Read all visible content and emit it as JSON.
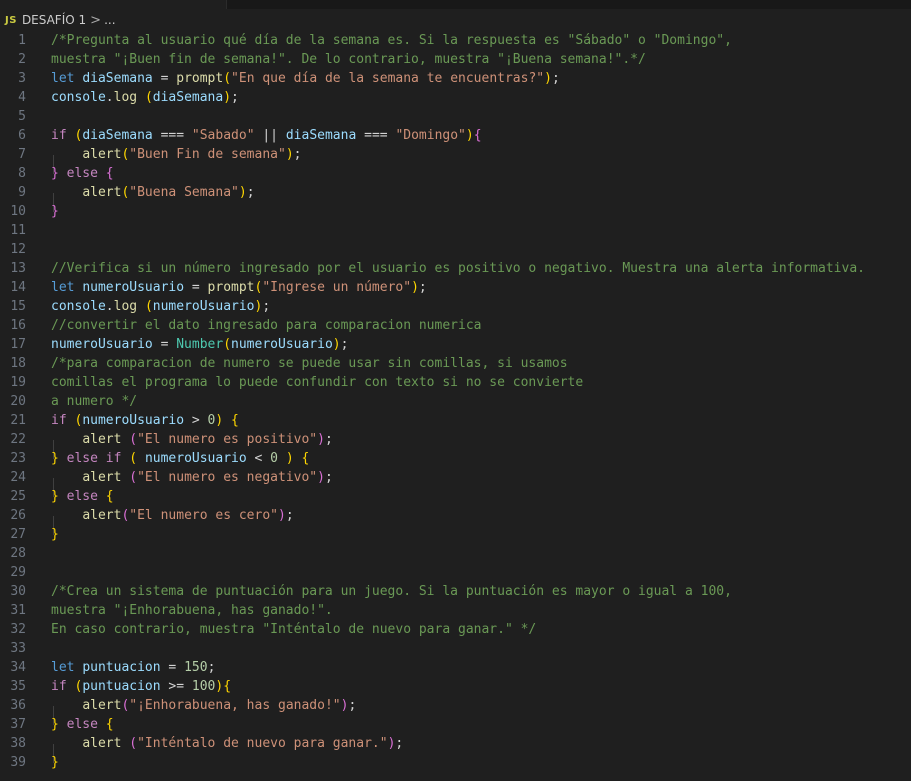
{
  "breadcrumb": {
    "file_icon_label": "JS",
    "folder": "DESAFÍO 1",
    "separator": ">",
    "more": "..."
  },
  "colors": {
    "comment": "#6a9955",
    "keyword": "#569cd6",
    "control": "#c586c0",
    "variable": "#9cdcfe",
    "function": "#dcdcaa",
    "string": "#ce9178",
    "number": "#b5cea8",
    "type": "#4ec9b0",
    "bracket_level1": "#ffd700",
    "bracket_level2": "#da70d6"
  },
  "lines": [
    {
      "n": "1",
      "t": [
        {
          "c": "comment",
          "v": "/*Pregunta al usuario qué día de la semana es. Si la respuesta es \"Sábado\" o \"Domingo\","
        }
      ]
    },
    {
      "n": "2",
      "t": [
        {
          "c": "comment",
          "v": "muestra \"¡Buen fin de semana!\". De lo contrario, muestra \"¡Buena semana!\".*/"
        }
      ]
    },
    {
      "n": "3",
      "t": [
        {
          "c": "kw",
          "v": "let"
        },
        {
          "c": "op",
          "v": " "
        },
        {
          "c": "var",
          "v": "diaSemana"
        },
        {
          "c": "op",
          "v": " = "
        },
        {
          "c": "fn",
          "v": "prompt"
        },
        {
          "c": "b1",
          "v": "("
        },
        {
          "c": "str",
          "v": "\"En que día de la semana te encuentras?\""
        },
        {
          "c": "b1",
          "v": ")"
        },
        {
          "c": "op",
          "v": ";"
        }
      ]
    },
    {
      "n": "4",
      "t": [
        {
          "c": "var",
          "v": "console"
        },
        {
          "c": "op",
          "v": "."
        },
        {
          "c": "fn",
          "v": "log"
        },
        {
          "c": "op",
          "v": " "
        },
        {
          "c": "b1",
          "v": "("
        },
        {
          "c": "var",
          "v": "diaSemana"
        },
        {
          "c": "b1",
          "v": ")"
        },
        {
          "c": "op",
          "v": ";"
        }
      ]
    },
    {
      "n": "5",
      "t": []
    },
    {
      "n": "6",
      "t": [
        {
          "c": "ctrl",
          "v": "if"
        },
        {
          "c": "op",
          "v": " "
        },
        {
          "c": "b1",
          "v": "("
        },
        {
          "c": "var",
          "v": "diaSemana"
        },
        {
          "c": "op",
          "v": " === "
        },
        {
          "c": "str",
          "v": "\"Sabado\""
        },
        {
          "c": "op",
          "v": " || "
        },
        {
          "c": "var",
          "v": "diaSemana"
        },
        {
          "c": "op",
          "v": " === "
        },
        {
          "c": "str",
          "v": "\"Domingo\""
        },
        {
          "c": "b1",
          "v": ")"
        },
        {
          "c": "b2",
          "v": "{"
        }
      ]
    },
    {
      "n": "7",
      "t": [
        {
          "c": "op",
          "v": "    "
        },
        {
          "c": "fn",
          "v": "alert"
        },
        {
          "c": "b1",
          "v": "("
        },
        {
          "c": "str",
          "v": "\"Buen Fin de semana\""
        },
        {
          "c": "b1",
          "v": ")"
        },
        {
          "c": "op",
          "v": ";"
        }
      ]
    },
    {
      "n": "8",
      "t": [
        {
          "c": "b2",
          "v": "}"
        },
        {
          "c": "op",
          "v": " "
        },
        {
          "c": "ctrl",
          "v": "else"
        },
        {
          "c": "op",
          "v": " "
        },
        {
          "c": "b2",
          "v": "{"
        }
      ]
    },
    {
      "n": "9",
      "t": [
        {
          "c": "op",
          "v": "    "
        },
        {
          "c": "fn",
          "v": "alert"
        },
        {
          "c": "b1",
          "v": "("
        },
        {
          "c": "str",
          "v": "\"Buena Semana\""
        },
        {
          "c": "b1",
          "v": ")"
        },
        {
          "c": "op",
          "v": ";"
        }
      ]
    },
    {
      "n": "10",
      "t": [
        {
          "c": "b2",
          "v": "}"
        }
      ]
    },
    {
      "n": "11",
      "t": []
    },
    {
      "n": "12",
      "t": []
    },
    {
      "n": "13",
      "t": [
        {
          "c": "comment",
          "v": "//Verifica si un número ingresado por el usuario es positivo o negativo. Muestra una alerta informativa."
        }
      ]
    },
    {
      "n": "14",
      "t": [
        {
          "c": "kw",
          "v": "let"
        },
        {
          "c": "op",
          "v": " "
        },
        {
          "c": "var",
          "v": "numeroUsuario"
        },
        {
          "c": "op",
          "v": " = "
        },
        {
          "c": "fn",
          "v": "prompt"
        },
        {
          "c": "b1",
          "v": "("
        },
        {
          "c": "str",
          "v": "\"Ingrese un número\""
        },
        {
          "c": "b1",
          "v": ")"
        },
        {
          "c": "op",
          "v": ";"
        }
      ]
    },
    {
      "n": "15",
      "t": [
        {
          "c": "var",
          "v": "console"
        },
        {
          "c": "op",
          "v": "."
        },
        {
          "c": "fn",
          "v": "log"
        },
        {
          "c": "op",
          "v": " "
        },
        {
          "c": "b1",
          "v": "("
        },
        {
          "c": "var",
          "v": "numeroUsuario"
        },
        {
          "c": "b1",
          "v": ")"
        },
        {
          "c": "op",
          "v": ";"
        }
      ]
    },
    {
      "n": "16",
      "t": [
        {
          "c": "comment",
          "v": "//convertir el dato ingresado para comparacion numerica"
        }
      ]
    },
    {
      "n": "17",
      "t": [
        {
          "c": "var",
          "v": "numeroUsuario"
        },
        {
          "c": "op",
          "v": " = "
        },
        {
          "c": "type",
          "v": "Number"
        },
        {
          "c": "b1",
          "v": "("
        },
        {
          "c": "var",
          "v": "numeroUsuario"
        },
        {
          "c": "b1",
          "v": ")"
        },
        {
          "c": "op",
          "v": ";"
        }
      ]
    },
    {
      "n": "18",
      "t": [
        {
          "c": "comment",
          "v": "/*para comparacion de numero se puede usar sin comillas, si usamos"
        }
      ]
    },
    {
      "n": "19",
      "t": [
        {
          "c": "comment",
          "v": "comillas el programa lo puede confundir con texto si no se convierte"
        }
      ]
    },
    {
      "n": "20",
      "t": [
        {
          "c": "comment",
          "v": "a numero */"
        }
      ]
    },
    {
      "n": "21",
      "t": [
        {
          "c": "ctrl",
          "v": "if"
        },
        {
          "c": "op",
          "v": " "
        },
        {
          "c": "b1",
          "v": "("
        },
        {
          "c": "var",
          "v": "numeroUsuario"
        },
        {
          "c": "op",
          "v": " > "
        },
        {
          "c": "num",
          "v": "0"
        },
        {
          "c": "b1",
          "v": ")"
        },
        {
          "c": "op",
          "v": " "
        },
        {
          "c": "b1",
          "v": "{"
        }
      ]
    },
    {
      "n": "22",
      "t": [
        {
          "c": "op",
          "v": "    "
        },
        {
          "c": "fn",
          "v": "alert"
        },
        {
          "c": "op",
          "v": " "
        },
        {
          "c": "b2",
          "v": "("
        },
        {
          "c": "str",
          "v": "\"El numero es positivo\""
        },
        {
          "c": "b2",
          "v": ")"
        },
        {
          "c": "op",
          "v": ";"
        }
      ]
    },
    {
      "n": "23",
      "t": [
        {
          "c": "b1",
          "v": "}"
        },
        {
          "c": "op",
          "v": " "
        },
        {
          "c": "ctrl",
          "v": "else"
        },
        {
          "c": "op",
          "v": " "
        },
        {
          "c": "ctrl",
          "v": "if"
        },
        {
          "c": "op",
          "v": " "
        },
        {
          "c": "b1",
          "v": "("
        },
        {
          "c": "op",
          "v": " "
        },
        {
          "c": "var",
          "v": "numeroUsuario"
        },
        {
          "c": "op",
          "v": " < "
        },
        {
          "c": "num",
          "v": "0"
        },
        {
          "c": "op",
          "v": " "
        },
        {
          "c": "b1",
          "v": ")"
        },
        {
          "c": "op",
          "v": " "
        },
        {
          "c": "b1",
          "v": "{"
        }
      ]
    },
    {
      "n": "24",
      "t": [
        {
          "c": "op",
          "v": "    "
        },
        {
          "c": "fn",
          "v": "alert"
        },
        {
          "c": "op",
          "v": " "
        },
        {
          "c": "b2",
          "v": "("
        },
        {
          "c": "str",
          "v": "\"El numero es negativo\""
        },
        {
          "c": "b2",
          "v": ")"
        },
        {
          "c": "op",
          "v": ";"
        }
      ]
    },
    {
      "n": "25",
      "t": [
        {
          "c": "b1",
          "v": "}"
        },
        {
          "c": "op",
          "v": " "
        },
        {
          "c": "ctrl",
          "v": "else"
        },
        {
          "c": "op",
          "v": " "
        },
        {
          "c": "b1",
          "v": "{"
        }
      ]
    },
    {
      "n": "26",
      "t": [
        {
          "c": "op",
          "v": "    "
        },
        {
          "c": "fn",
          "v": "alert"
        },
        {
          "c": "b2",
          "v": "("
        },
        {
          "c": "str",
          "v": "\"El numero es cero\""
        },
        {
          "c": "b2",
          "v": ")"
        },
        {
          "c": "op",
          "v": ";"
        }
      ]
    },
    {
      "n": "27",
      "t": [
        {
          "c": "b1",
          "v": "}"
        }
      ]
    },
    {
      "n": "28",
      "t": []
    },
    {
      "n": "29",
      "t": []
    },
    {
      "n": "30",
      "t": [
        {
          "c": "comment",
          "v": "/*Crea un sistema de puntuación para un juego. Si la puntuación es mayor o igual a 100,"
        }
      ]
    },
    {
      "n": "31",
      "t": [
        {
          "c": "comment",
          "v": "muestra \"¡Enhorabuena, has ganado!\"."
        }
      ]
    },
    {
      "n": "32",
      "t": [
        {
          "c": "comment",
          "v": "En caso contrario, muestra \"Inténtalo de nuevo para ganar.\" */"
        }
      ]
    },
    {
      "n": "33",
      "t": []
    },
    {
      "n": "34",
      "t": [
        {
          "c": "kw",
          "v": "let"
        },
        {
          "c": "op",
          "v": " "
        },
        {
          "c": "var",
          "v": "puntuacion"
        },
        {
          "c": "op",
          "v": " = "
        },
        {
          "c": "num",
          "v": "150"
        },
        {
          "c": "op",
          "v": ";"
        }
      ]
    },
    {
      "n": "35",
      "t": [
        {
          "c": "ctrl",
          "v": "if"
        },
        {
          "c": "op",
          "v": " "
        },
        {
          "c": "b1",
          "v": "("
        },
        {
          "c": "var",
          "v": "puntuacion"
        },
        {
          "c": "op",
          "v": " >= "
        },
        {
          "c": "num",
          "v": "100"
        },
        {
          "c": "b1",
          "v": ")"
        },
        {
          "c": "b1",
          "v": "{"
        }
      ]
    },
    {
      "n": "36",
      "t": [
        {
          "c": "op",
          "v": "    "
        },
        {
          "c": "fn",
          "v": "alert"
        },
        {
          "c": "b2",
          "v": "("
        },
        {
          "c": "str",
          "v": "\"¡Enhorabuena, has ganado!\""
        },
        {
          "c": "b2",
          "v": ")"
        },
        {
          "c": "op",
          "v": ";"
        }
      ]
    },
    {
      "n": "37",
      "t": [
        {
          "c": "b1",
          "v": "}"
        },
        {
          "c": "op",
          "v": " "
        },
        {
          "c": "ctrl",
          "v": "else"
        },
        {
          "c": "op",
          "v": " "
        },
        {
          "c": "b1",
          "v": "{"
        }
      ]
    },
    {
      "n": "38",
      "t": [
        {
          "c": "op",
          "v": "    "
        },
        {
          "c": "fn",
          "v": "alert"
        },
        {
          "c": "op",
          "v": " "
        },
        {
          "c": "b2",
          "v": "("
        },
        {
          "c": "str",
          "v": "\"Inténtalo de nuevo para ganar.\""
        },
        {
          "c": "b2",
          "v": ")"
        },
        {
          "c": "op",
          "v": ";"
        }
      ]
    },
    {
      "n": "39",
      "t": [
        {
          "c": "b1",
          "v": "}"
        }
      ]
    }
  ]
}
